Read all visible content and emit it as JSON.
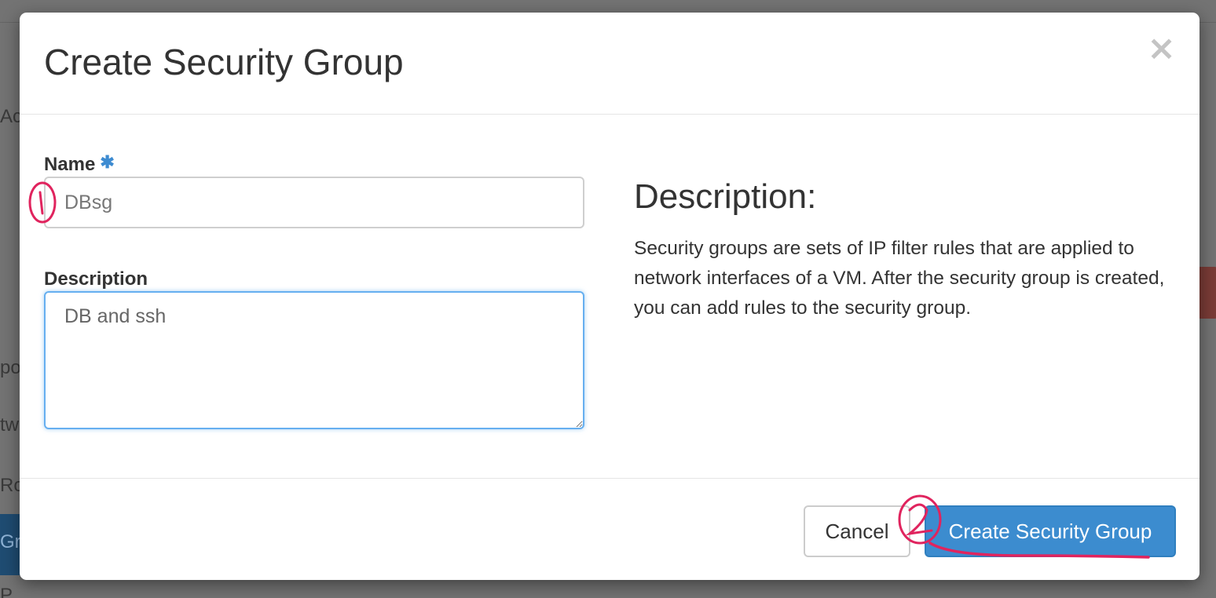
{
  "background": {
    "fragments": [
      "Ac",
      "po",
      "tw",
      "Ro",
      "Gr",
      "P"
    ]
  },
  "modal": {
    "title": "Create Security Group",
    "close_icon": "close-icon"
  },
  "form": {
    "name_label": "Name",
    "required_mark": "✱",
    "name_value": "DBsg",
    "description_label": "Description",
    "description_value": "DB and ssh"
  },
  "help": {
    "title": "Description:",
    "text": "Security groups are sets of IP filter rules that are applied to network interfaces of a VM. After the security group is created, you can add rules to the security group."
  },
  "footer": {
    "cancel_label": "Cancel",
    "submit_label": "Create Security Group"
  },
  "annotations": {
    "marker_1": "1",
    "marker_2": "2",
    "ink_color": "#e0245e"
  }
}
